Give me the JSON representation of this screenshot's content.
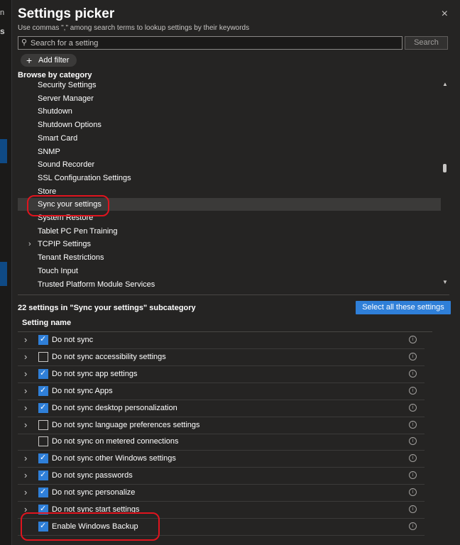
{
  "backdrop": {
    "frag_text": "n",
    "frag2_text": "s"
  },
  "dialog": {
    "title": "Settings picker",
    "subtitle": "Use commas \",\" among search terms to lookup settings by their keywords",
    "close_icon": "×",
    "search": {
      "placeholder": "Search for a setting",
      "value": "",
      "button_label": "Search",
      "icon": "⚲"
    },
    "add_filter": {
      "icon": "+",
      "label": "Add filter"
    },
    "browse_label": "Browse by category"
  },
  "categories": [
    {
      "label": "Security Settings",
      "expandable": false,
      "selected": false
    },
    {
      "label": "Server Manager",
      "expandable": false,
      "selected": false
    },
    {
      "label": "Shutdown",
      "expandable": false,
      "selected": false
    },
    {
      "label": "Shutdown Options",
      "expandable": false,
      "selected": false
    },
    {
      "label": "Smart Card",
      "expandable": false,
      "selected": false
    },
    {
      "label": "SNMP",
      "expandable": false,
      "selected": false
    },
    {
      "label": "Sound Recorder",
      "expandable": false,
      "selected": false
    },
    {
      "label": "SSL Configuration Settings",
      "expandable": false,
      "selected": false
    },
    {
      "label": "Store",
      "expandable": false,
      "selected": false
    },
    {
      "label": "Sync your settings",
      "expandable": false,
      "selected": true
    },
    {
      "label": "System Restore",
      "expandable": false,
      "selected": false
    },
    {
      "label": "Tablet PC Pen Training",
      "expandable": false,
      "selected": false
    },
    {
      "label": "TCPIP Settings",
      "expandable": true,
      "selected": false
    },
    {
      "label": "Tenant Restrictions",
      "expandable": false,
      "selected": false
    },
    {
      "label": "Touch Input",
      "expandable": false,
      "selected": false
    },
    {
      "label": "Trusted Platform Module Services",
      "expandable": false,
      "selected": false
    }
  ],
  "results": {
    "count_label": "22 settings in \"Sync your settings\" subcategory",
    "select_all_label": "Select all these settings",
    "column_header": "Setting name"
  },
  "settings": [
    {
      "label": "Do not sync",
      "checked": true,
      "expandable": true
    },
    {
      "label": "Do not sync accessibility settings",
      "checked": false,
      "expandable": true
    },
    {
      "label": "Do not sync app settings",
      "checked": true,
      "expandable": true
    },
    {
      "label": "Do not sync Apps",
      "checked": true,
      "expandable": true
    },
    {
      "label": "Do not sync desktop personalization",
      "checked": true,
      "expandable": true
    },
    {
      "label": "Do not sync language preferences settings",
      "checked": false,
      "expandable": true
    },
    {
      "label": "Do not sync on metered connections",
      "checked": false,
      "expandable": false
    },
    {
      "label": "Do not sync other Windows settings",
      "checked": true,
      "expandable": true
    },
    {
      "label": "Do not sync passwords",
      "checked": true,
      "expandable": true
    },
    {
      "label": "Do not sync personalize",
      "checked": true,
      "expandable": true
    },
    {
      "label": "Do not sync start settings",
      "checked": true,
      "expandable": true
    },
    {
      "label": "Enable Windows Backup",
      "checked": true,
      "expandable": false
    }
  ],
  "icons": {
    "chevron": "›",
    "expander": "›",
    "check": "✓",
    "info": "i",
    "scroll_up": "▲",
    "scroll_down": "▼"
  },
  "colors": {
    "accent": "#2f7fd8",
    "panel": "#252423",
    "callout": "#e0141e"
  }
}
